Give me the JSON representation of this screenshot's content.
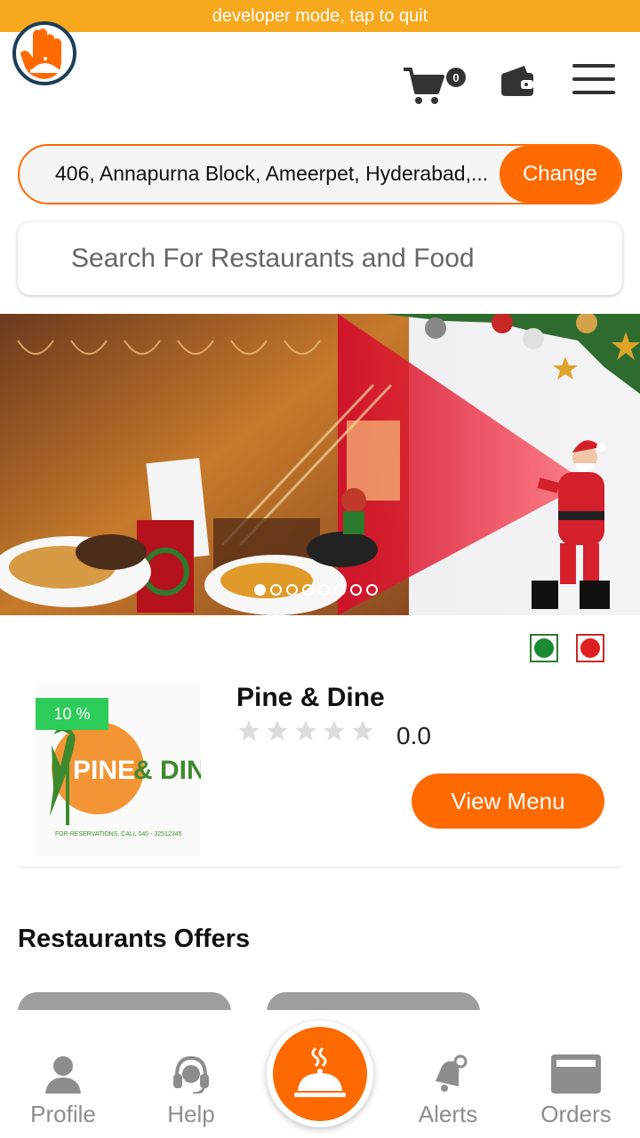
{
  "dev_banner": "developer mode, tap to quit",
  "header": {
    "cart_count": "0",
    "logo_icon": "hand-cloche-icon",
    "cart_icon": "cart-icon",
    "wallet_icon": "wallet-icon",
    "menu_icon": "hamburger-menu-icon"
  },
  "location": {
    "address": "406, Annapurna Block, Ameerpet, Hyderabad,...",
    "change_label": "Change"
  },
  "search": {
    "placeholder": "Search For Restaurants and Food"
  },
  "banner": {
    "slide_count": 8,
    "active_slide": 1
  },
  "filters": {
    "veg_icon": "veg-indicator-icon",
    "nonveg_icon": "nonveg-indicator-icon"
  },
  "restaurant": {
    "name": "Pine & Dine",
    "discount": "10 %",
    "rating": "0.0",
    "rating_stars_filled": 0,
    "rating_stars_total": 5,
    "view_menu_label": "View Menu",
    "logo_text_left": "PINE",
    "logo_text_right": "& DINE",
    "logo_footer": "FOR RESERVATIONS, CALL 040 - 32512345"
  },
  "offers": {
    "title": "Restaurants Offers"
  },
  "nav": {
    "items": [
      {
        "label": "Profile",
        "icon": "person-icon"
      },
      {
        "label": "Help",
        "icon": "headset-icon"
      },
      {
        "label": "Alerts",
        "icon": "bell-icon"
      },
      {
        "label": "Orders",
        "icon": "orders-icon"
      }
    ],
    "center_icon": "cloche-icon"
  },
  "colors": {
    "accent": "#ff6a00",
    "dev_bar": "#f8a81d",
    "discount_green": "#2ecc5a",
    "nav_gray": "#8d8d8d"
  }
}
